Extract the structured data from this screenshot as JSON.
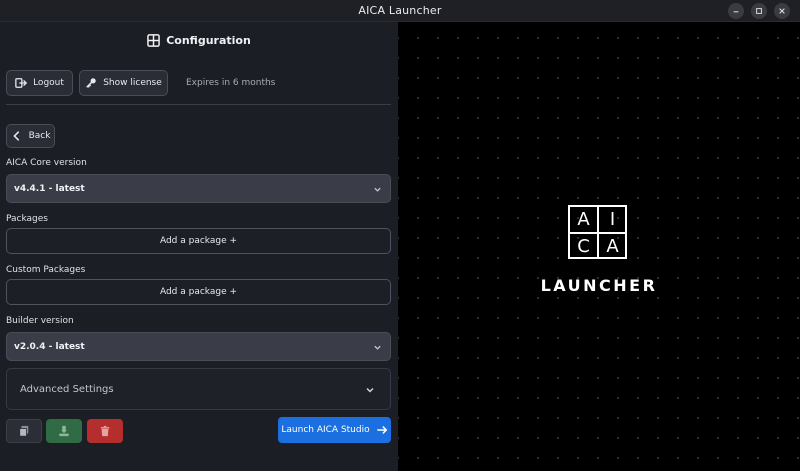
{
  "window": {
    "title": "AICA Launcher"
  },
  "header": {
    "title": "Configuration",
    "icon": "layout-icon"
  },
  "account": {
    "logout_label": "Logout",
    "show_license_label": "Show license",
    "expires_text": "Expires in 6 months"
  },
  "nav": {
    "back_label": "Back"
  },
  "core": {
    "label": "AICA Core version",
    "selected": "v4.4.1 - latest"
  },
  "packages": {
    "label": "Packages",
    "add_label": "Add a package +"
  },
  "custom_packages": {
    "label": "Custom Packages",
    "add_label": "Add a package +"
  },
  "builder": {
    "label": "Builder version",
    "selected": "v2.0.4 - latest"
  },
  "advanced": {
    "label": "Advanced Settings"
  },
  "actions": {
    "launch_label": "Launch AICA Studio",
    "copy_icon": "copy-icon",
    "import_icon": "import-icon",
    "delete_icon": "trash-icon"
  },
  "branding": {
    "logo_cells": [
      "A",
      "I",
      "C",
      "A"
    ],
    "subtitle": "LAUNCHER"
  },
  "colors": {
    "accent": "#1c6fe0",
    "success": "#2f6b44",
    "danger": "#b42e2e",
    "panel": "#1c1e25",
    "canvas": "#000000"
  }
}
